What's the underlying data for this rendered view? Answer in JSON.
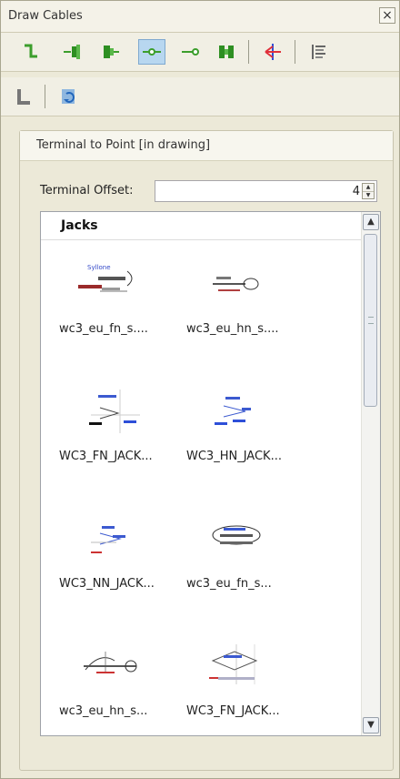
{
  "window": {
    "title": "Draw Cables",
    "close_icon": "close-icon"
  },
  "toolbar1": {
    "icons": [
      "cable-angle-icon",
      "terminal-left-icon",
      "terminal-right-icon",
      "terminal-to-point-icon",
      "point-to-terminal-icon",
      "terminal-pair-icon",
      "cable-split-icon",
      "properties-list-icon"
    ],
    "active": "terminal-to-point-icon"
  },
  "toolbar2": {
    "icons": [
      "cable-bend-icon",
      "refresh-catalog-icon"
    ]
  },
  "group": {
    "title": "Terminal to Point [in drawing]"
  },
  "offset": {
    "label": "Terminal Offset:",
    "value": "4"
  },
  "list": {
    "title": "Jacks",
    "items": [
      {
        "caption": "wc3_eu_fn_s....",
        "thumb_text": "Syllone"
      },
      {
        "caption": "wc3_eu_hn_s....",
        "thumb_text": ""
      },
      {
        "caption": "WC3_FN_JACK...",
        "thumb_text": ""
      },
      {
        "caption": "WC3_HN_JACK...",
        "thumb_text": ""
      },
      {
        "caption": "WC3_NN_JACK...",
        "thumb_text": ""
      },
      {
        "caption": "wc3_eu_fn_s...",
        "thumb_text": ""
      },
      {
        "caption": "wc3_eu_hn_s...",
        "thumb_text": ""
      },
      {
        "caption": "WC3_FN_JACK...",
        "thumb_text": ""
      }
    ]
  }
}
